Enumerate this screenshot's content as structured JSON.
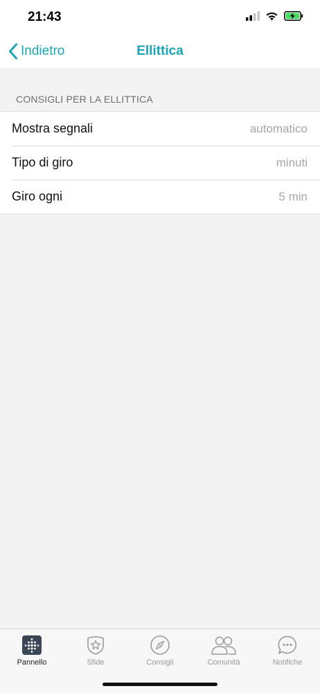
{
  "status_bar": {
    "time": "21:43"
  },
  "nav": {
    "back_label": "Indietro",
    "title": "Ellittica",
    "accent_color": "#1aa6b7"
  },
  "section": {
    "header": "CONSIGLI PER LA ELLITTICA"
  },
  "settings": {
    "rows": [
      {
        "label": "Mostra segnali",
        "value": "automatico"
      },
      {
        "label": "Tipo di giro",
        "value": "minuti"
      },
      {
        "label": "Giro ogni",
        "value": "5 min"
      }
    ]
  },
  "tab_bar": {
    "tabs": [
      {
        "label": "Pannello",
        "icon": "dashboard-grid-icon",
        "active": true
      },
      {
        "label": "Sfide",
        "icon": "star-badge-icon",
        "active": false
      },
      {
        "label": "Consigli",
        "icon": "compass-icon",
        "active": false
      },
      {
        "label": "Comunità",
        "icon": "people-icon",
        "active": false
      },
      {
        "label": "Notifiche",
        "icon": "chat-bubble-icon",
        "active": false
      }
    ]
  }
}
